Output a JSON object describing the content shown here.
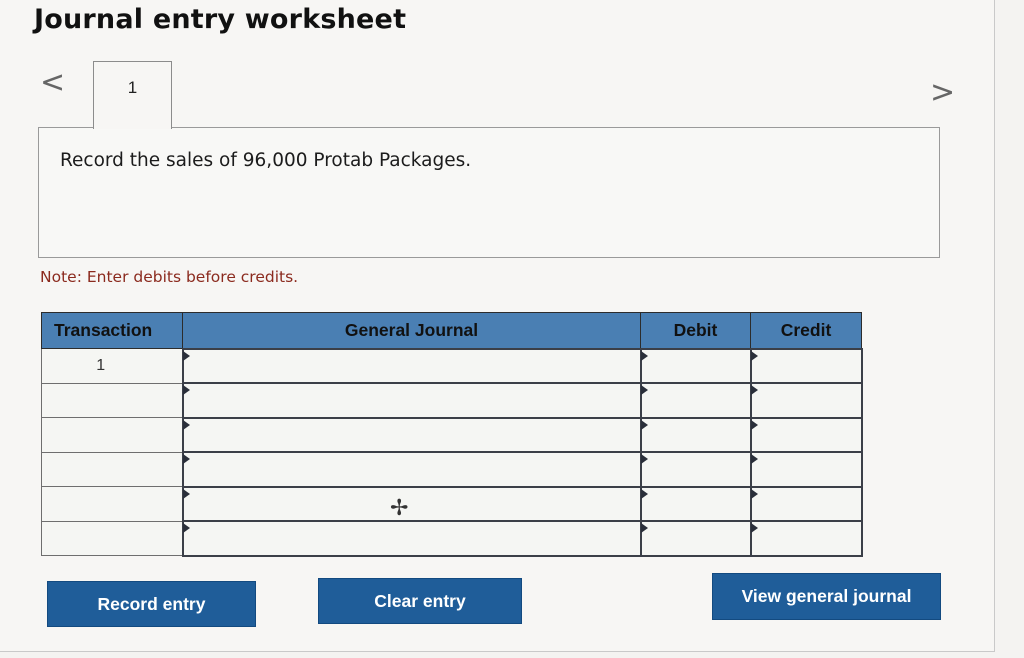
{
  "header": {
    "title": "Journal entry worksheet"
  },
  "nav": {
    "prev_glyph": "<",
    "next_glyph": ">"
  },
  "tabs": [
    {
      "label": "1"
    }
  ],
  "prompt": {
    "text": "Record the sales of 96,000 Protab Packages."
  },
  "note": {
    "text": "Note: Enter debits before credits."
  },
  "table": {
    "headers": {
      "transaction": "Transaction",
      "journal": "General Journal",
      "debit": "Debit",
      "credit": "Credit"
    },
    "rows": [
      {
        "transaction": "1",
        "journal": "",
        "debit": "",
        "credit": ""
      },
      {
        "transaction": "",
        "journal": "",
        "debit": "",
        "credit": ""
      },
      {
        "transaction": "",
        "journal": "",
        "debit": "",
        "credit": ""
      },
      {
        "transaction": "",
        "journal": "",
        "debit": "",
        "credit": ""
      },
      {
        "transaction": "",
        "journal": "",
        "debit": "",
        "credit": ""
      },
      {
        "transaction": "",
        "journal": "",
        "debit": "",
        "credit": ""
      }
    ]
  },
  "buttons": {
    "record": "Record entry",
    "clear": "Clear entry",
    "view": "View general journal"
  },
  "icons": {
    "cursor": "move-cursor-icon"
  },
  "colors": {
    "header_bg": "#4a7fb3",
    "button_bg": "#1f5d99",
    "note_color": "#8b2a1e"
  }
}
